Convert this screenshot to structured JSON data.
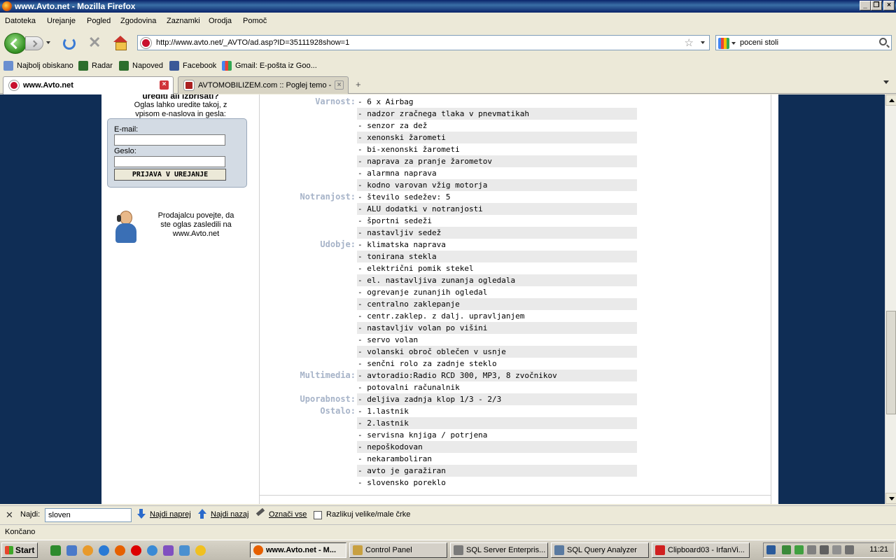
{
  "window": {
    "title": "www.Avto.net - Mozilla Firefox"
  },
  "menu": [
    "Datoteka",
    "Urejanje",
    "Pogled",
    "Zgodovina",
    "Zaznamki",
    "Orodja",
    "Pomoč"
  ],
  "nav": {
    "url": "http://www.avto.net/_AVTO/ad.asp?ID=35111928show=1",
    "search_value": "poceni stoli"
  },
  "bookmarks": [
    "Najbolj obiskano",
    "Radar",
    "Napoved",
    "Facebook",
    "Gmail: E-pošta iz Goo..."
  ],
  "tabs": [
    {
      "label": "www.Avto.net"
    },
    {
      "label": "AVTOMOBILIZEM.com :: Poglej temo - ..."
    }
  ],
  "sidebar": {
    "heading": "urediti ali izbrisati?",
    "hint_line1": "Oglas lahko uredite takoj, z",
    "hint_line2": "vpisom e-naslova in gesla:",
    "email_label": "E-mail:",
    "password_label": "Geslo:",
    "login_button": "PRIJAVA V UREJANJE",
    "seller_line1": "Prodajalcu povejte, da",
    "seller_line2": "ste oglas zasledili na",
    "seller_line3": "www.Avto.net"
  },
  "equipment": [
    {
      "category": "Varnost:",
      "items": [
        "- 6 x Airbag",
        "- nadzor zračnega tlaka v pnevmatikah",
        "- senzor za dež",
        "- xenonski žarometi",
        "- bi-xenonski žarometi",
        "- naprava za pranje žarometov",
        "- alarmna naprava",
        "- kodno varovan vžig motorja"
      ]
    },
    {
      "category": "Notranjost:",
      "items": [
        "- število sedežev: 5",
        "- ALU dodatki v notranjosti",
        "- športni sedeži",
        "- nastavljiv sedež"
      ]
    },
    {
      "category": "Udobje:",
      "items": [
        "- klimatska naprava",
        "- tonirana stekla",
        "- električni pomik stekel",
        "- el. nastavljiva zunanja ogledala",
        "- ogrevanje zunanjih ogledal",
        "- centralno zaklepanje",
        "- centr.zaklep. z dalj. upravljanjem",
        "- nastavljiv volan po višini",
        "- servo volan",
        "- volanski obroč oblečen v usnje",
        "- senčni rolo za zadnje steklo"
      ]
    },
    {
      "category": "Multimedia:",
      "items": [
        "- avtoradio:Radio RCD 300, MP3, 8 zvočnikov",
        "- potovalni računalnik"
      ]
    },
    {
      "category": "Uporabnost:",
      "items": [
        "- deljiva zadnja klop 1/3 - 2/3"
      ]
    },
    {
      "category": "Ostalo:",
      "items": [
        "- 1.lastnik",
        "- 2.lastnik",
        "- servisna knjiga / potrjena",
        "- nepoškodovan",
        "- nekaramboliran",
        "- avto je garažiran",
        "- slovensko poreklo"
      ]
    }
  ],
  "findbar": {
    "label": "Najdi:",
    "value": "sloven",
    "next": "Najdi naprej",
    "prev": "Najdi nazaj",
    "highlight": "Označi vse",
    "match_case": "Razlikuj velike/male črke"
  },
  "status": "Končano",
  "taskbar": {
    "start": "Start",
    "tasks": [
      "www.Avto.net - M...",
      "Control Panel",
      "SQL Server Enterpris...",
      "SQL Query Analyzer",
      "Clipboard03 - IrfanVi..."
    ],
    "clock": "11:21"
  }
}
